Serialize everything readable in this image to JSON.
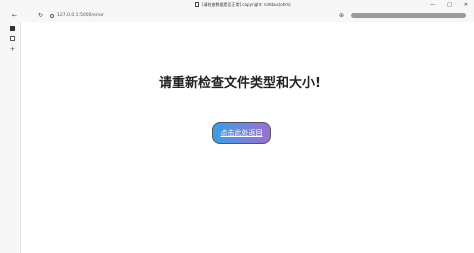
{
  "window": {
    "title": "[请检查数据是否正常] copyright: nimbus(ohm)",
    "controls": {
      "minimize": "—",
      "maximize": "□",
      "close": "✕"
    }
  },
  "toolbar": {
    "back": "←",
    "reload": "↻",
    "url": "127.0.0.1:5000/error",
    "zoom": "⊕"
  },
  "page": {
    "heading": "请重新检查文件类型和大小!",
    "back_button_label": "点击此处返回"
  },
  "colors": {
    "button_gradient_start": "#3a9ee6",
    "button_gradient_end": "#9c6fd0"
  }
}
